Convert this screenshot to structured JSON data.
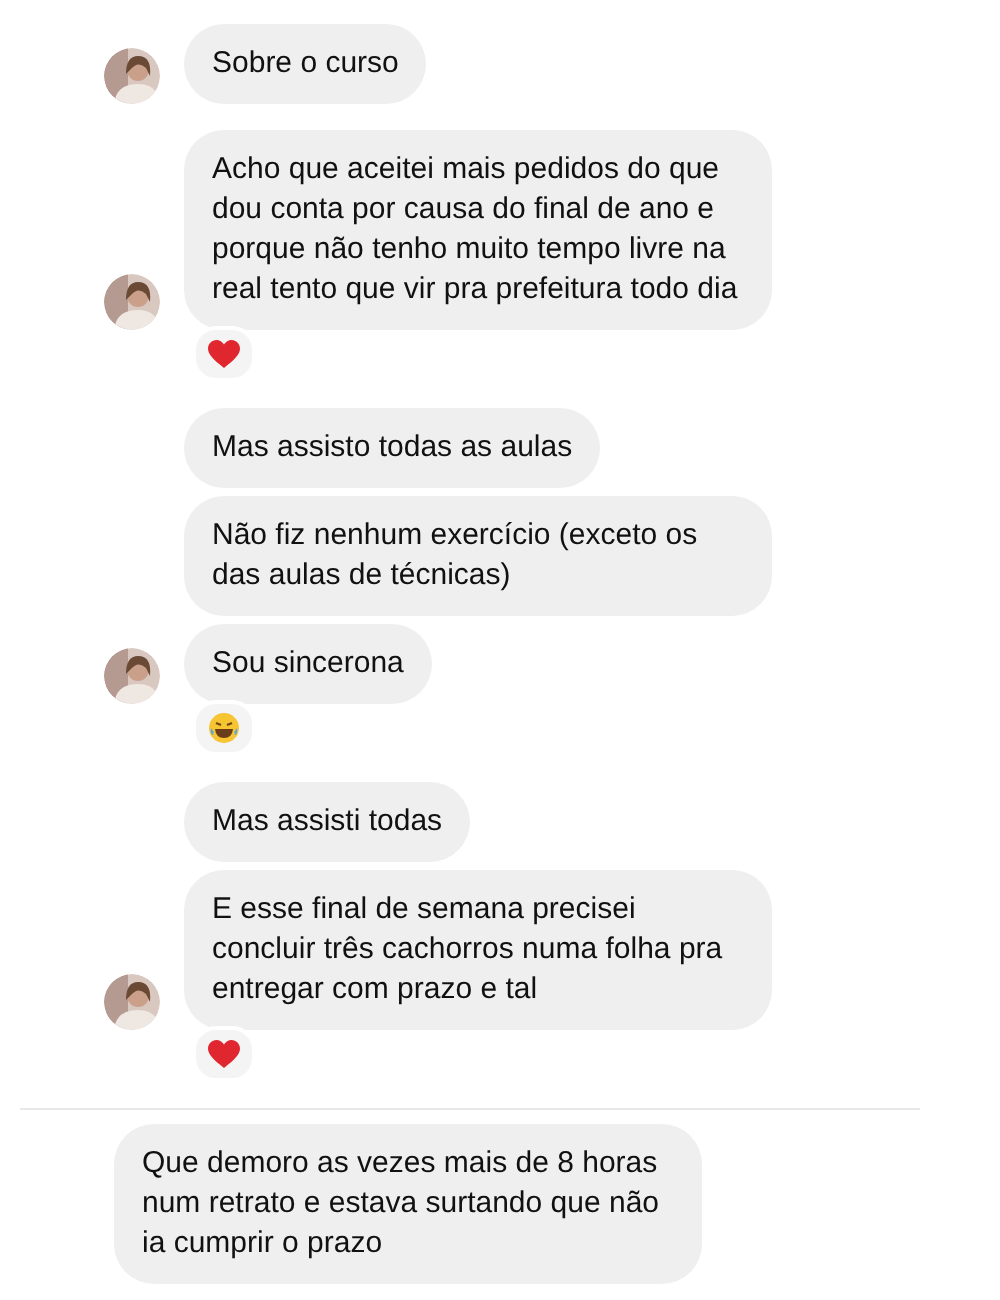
{
  "groups": [
    {
      "messages": [
        "Sobre o curso"
      ],
      "avatar": true
    },
    {
      "messages": [
        "Acho que aceitei mais pedidos do que dou conta por causa do final de ano e porque não tenho muito tempo livre na real tento que vir pra prefeitura todo dia"
      ],
      "reaction": {
        "kind": "heart"
      },
      "avatar": true
    },
    {
      "messages": [
        "Mas assisto todas as aulas",
        "Não fiz nenhum exercício (exceto os das aulas de técnicas)",
        "Sou sincerona"
      ],
      "reaction": {
        "kind": "laugh"
      },
      "avatar": true
    },
    {
      "messages": [
        "Mas assisti todas",
        "E esse final de semana precisei concluir três cachorros numa folha pra entregar com prazo e tal"
      ],
      "reaction": {
        "kind": "heart"
      },
      "avatar": true,
      "divider_after": true
    },
    {
      "messages": [
        "Que demoro as vezes mais de 8 horas num retrato e estava surtando que não ia cumprir o prazo"
      ],
      "avatar": false
    }
  ]
}
